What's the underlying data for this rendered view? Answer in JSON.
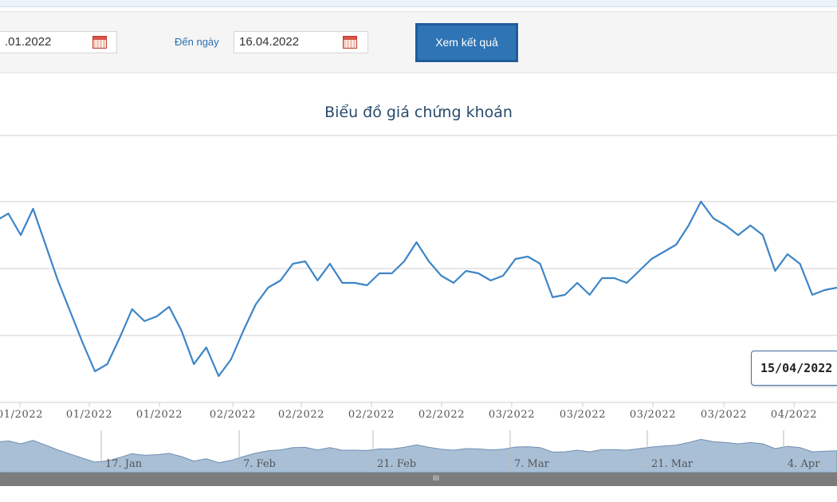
{
  "filter": {
    "from_date_value": ".01.2022",
    "to_label": "Đến ngày",
    "to_date_value": "16.04.2022",
    "submit_label": "Xem kết quả"
  },
  "chart_data": {
    "type": "line",
    "title": "Biểu đồ giá chứng khoán",
    "x_tick_labels": [
      "01/2022",
      "01/2022",
      "01/2022",
      "02/2022",
      "02/2022",
      "02/2022",
      "02/2022",
      "03/2022",
      "03/2022",
      "03/2022",
      "03/2022",
      "04/2022"
    ],
    "series": [
      {
        "values": [
          0.71,
          0.74,
          0.65,
          0.76,
          0.61,
          0.46,
          0.33,
          0.2,
          0.08,
          0.11,
          0.22,
          0.34,
          0.29,
          0.31,
          0.35,
          0.25,
          0.11,
          0.18,
          0.06,
          0.13,
          0.25,
          0.36,
          0.43,
          0.46,
          0.53,
          0.54,
          0.46,
          0.53,
          0.45,
          0.45,
          0.44,
          0.49,
          0.49,
          0.54,
          0.62,
          0.54,
          0.48,
          0.45,
          0.5,
          0.49,
          0.46,
          0.48,
          0.55,
          0.56,
          0.53,
          0.39,
          0.4,
          0.45,
          0.4,
          0.47,
          0.47,
          0.45,
          0.5,
          0.55,
          0.58,
          0.61,
          0.69,
          0.79,
          0.72,
          0.69,
          0.65,
          0.69,
          0.65,
          0.5,
          0.57,
          0.53,
          0.4,
          0.42,
          0.43
        ]
      }
    ],
    "navigator_labels": [
      "17. Jan",
      "7. Feb",
      "21. Feb",
      "7. Mar",
      "21. Mar",
      "4. Apr"
    ],
    "tooltip_date": "15/04/2022",
    "grid": true,
    "colors": {
      "line": "#3d85c6",
      "navigator_fill": "#a9bfd6",
      "navigator_line": "#6f8fb0"
    }
  },
  "scrollbar": {
    "grip": "III"
  }
}
